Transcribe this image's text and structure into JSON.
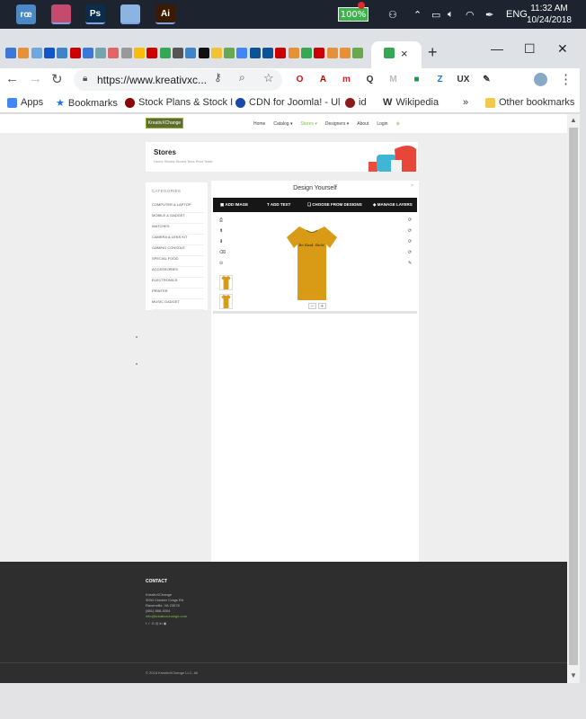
{
  "taskbar": {
    "apps": [
      {
        "name": "rocket-app-icon",
        "label": "rœ",
        "color": "#4a88c6"
      },
      {
        "name": "settings-app-icon",
        "label": "",
        "color": "#c54b6e"
      },
      {
        "name": "photoshop-icon",
        "label": "Ps",
        "color": "#0b2c4a"
      },
      {
        "name": "notepad-icon",
        "label": "",
        "color": "#8cb4e0"
      },
      {
        "name": "illustrator-icon",
        "label": "Ai",
        "color": "#3a1a00"
      }
    ],
    "battery": "100%",
    "language": "ENG",
    "time": "11:32 AM",
    "date": "10/24/2018"
  },
  "browser": {
    "url": "https://www.kreativxc...",
    "tab_fav_colors": [
      "#3c78d8",
      "#e69138",
      "#6fa8dc",
      "#1155cc",
      "#3d85c6",
      "#cc0000",
      "#3c78d8",
      "#76a5af",
      "#e06666",
      "#999999",
      "#fbbc04",
      "#cc0000",
      "#34a853",
      "#555555",
      "#3d85c6",
      "#111111",
      "#f1c232",
      "#6aa84f",
      "#4285f4",
      "#0b5394",
      "#0b5394",
      "#cc0000",
      "#e69138",
      "#34a853",
      "#cc0000",
      "#e69138",
      "#e69138",
      "#6aa84f"
    ],
    "close_glyph": "×",
    "newtab_glyph": "+",
    "window_buttons": [
      "—",
      "☐",
      "✕"
    ],
    "ext_icons": [
      {
        "name": "opera-icon",
        "label": "O",
        "color": "#cc0f16"
      },
      {
        "name": "adobe-pdf-icon",
        "label": "A",
        "color": "#b30b00"
      },
      {
        "name": "mendeley-icon",
        "label": "m",
        "color": "#d71e28"
      },
      {
        "name": "search-ext-icon",
        "label": "Q",
        "color": "#333333"
      },
      {
        "name": "gmail-icon",
        "label": "M",
        "color": "#bbbbbb"
      },
      {
        "name": "sheets-icon",
        "label": "■",
        "color": "#0f9d58"
      },
      {
        "name": "zotero-icon",
        "label": "Z",
        "color": "#1a73e8"
      },
      {
        "name": "ux-icon",
        "label": "UX",
        "color": "#333333"
      },
      {
        "name": "clipboard-icon",
        "label": "✎",
        "color": "#333333"
      }
    ]
  },
  "bookmarks": {
    "items": [
      {
        "label": "Apps",
        "color": "#4285f4"
      },
      {
        "label": "Bookmarks",
        "color": "#1a73e8"
      },
      {
        "label": "Stock Plans & Stock I",
        "color": "#8b0000"
      },
      {
        "label": "CDN for Joomla! - Ul",
        "color": "#1a4aa8"
      },
      {
        "label": "id",
        "color": "#8b1a1a"
      },
      {
        "label": "Wikipedia",
        "color": "#333333"
      }
    ],
    "overflow": "»",
    "other": "Other bookmarks"
  },
  "site": {
    "logo": "KreativXChange",
    "nav": [
      "Home",
      "Catalog ▾",
      "Stores ▾",
      "Designers ▾",
      "About",
      "Login"
    ],
    "banner": {
      "title": "Stores",
      "crumb": "Home   Stores   Stores Tees   Print Tshirt"
    },
    "categories": {
      "heading": "CATEGORIES",
      "items": [
        "COMPUTER & LAPTOP",
        "MOBILE & GADGET",
        "WATCHES",
        "CAMERA & LENS KIT",
        "GAMING CONSOLE",
        "SPECIAL FOOD",
        "ACCESSORIES",
        "ELECTRONICS",
        "PRINTER",
        "MUSIC GADGET"
      ]
    },
    "designer": {
      "title": "Design Yourself",
      "tools": [
        "ADD IMAGE",
        "ADD TEXT",
        "CHOOSE FROM DESIGNS",
        "MANAGE LAYERS"
      ],
      "shirt_color": "#d99a16",
      "shirt_text": "Be Kind. Rich!",
      "left_tools": [
        "⎙",
        "⬆",
        "⬇",
        "⌫",
        "⊙"
      ],
      "right_tools": [
        "⟳",
        "⟳",
        "⟳",
        "⟳",
        "✎"
      ]
    },
    "footer": {
      "title": "CONTACT",
      "lines": [
        "KreativXChange",
        "3094 Cracker Crags Rd",
        "Ravenville, VA 23078",
        "(881) 888-4004"
      ],
      "email": "info@kreativxchange.com",
      "social": "f  ✓  G  ◎  in  ◉",
      "copyright": "© 2018 KreativXChange LLC. All"
    }
  }
}
